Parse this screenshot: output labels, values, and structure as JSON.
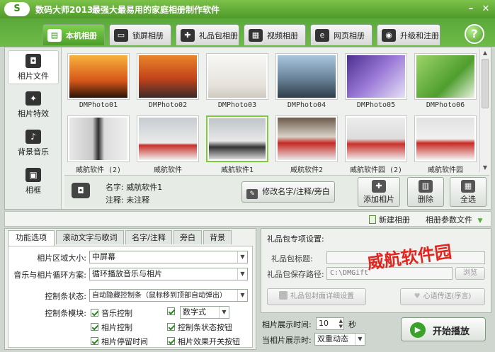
{
  "app": {
    "logo": "S",
    "title": "数码大师2013",
    "slogan": "最强大最易用的家庭相册制作软件",
    "minimize": "–",
    "close": "✕"
  },
  "tabs": [
    {
      "label": "本机相册",
      "icon": "computer-album-icon",
      "glyph": "▤",
      "active": true
    },
    {
      "label": "锁屏相册",
      "icon": "monitor-icon",
      "glyph": "▭",
      "active": false
    },
    {
      "label": "礼品包相册",
      "icon": "gift-icon",
      "glyph": "✚",
      "active": false
    },
    {
      "label": "视频相册",
      "icon": "film-icon",
      "glyph": "▦",
      "active": false
    },
    {
      "label": "网页相册",
      "icon": "ie-icon",
      "glyph": "e",
      "active": false
    },
    {
      "label": "升级和注册",
      "icon": "globe-icon",
      "glyph": "◉",
      "active": false
    }
  ],
  "help": "?",
  "sidebar": {
    "items": [
      {
        "label": "相片文件",
        "icon": "camera-icon",
        "glyph": "◘",
        "active": true
      },
      {
        "label": "相片特效",
        "icon": "effects-icon",
        "glyph": "✦",
        "active": false
      },
      {
        "label": "背景音乐",
        "icon": "music-note-icon",
        "glyph": "♪",
        "active": false
      },
      {
        "label": "相框",
        "icon": "frame-icon",
        "glyph": "▣",
        "active": false
      }
    ]
  },
  "photos": [
    {
      "caption": "DMPhoto01"
    },
    {
      "caption": "DMPhoto02"
    },
    {
      "caption": "DMPhoto03"
    },
    {
      "caption": "DMPhoto04"
    },
    {
      "caption": "DMPhoto05"
    },
    {
      "caption": "DMPhoto06"
    },
    {
      "caption": "威航软件 (2)"
    },
    {
      "caption": "威航软件"
    },
    {
      "caption": "威航软件1"
    },
    {
      "caption": "威航软件2"
    },
    {
      "caption": "威航软件园 (2)"
    },
    {
      "caption": "威航软件园"
    }
  ],
  "info": {
    "name_label": "名字:",
    "name_value": "威航软件1",
    "note_label": "注释:",
    "note_value": "未注释",
    "edit_button": "修改名字/注释/旁白",
    "add_button": "添加相片",
    "delete_button": "删除",
    "select_all_button": "全选"
  },
  "album_bar": {
    "new_album": "新建相册",
    "album_params": "相册参数文件"
  },
  "option_tabs": [
    "功能选项",
    "滚动文字与歌词",
    "名字/注释",
    "旁白",
    "背景"
  ],
  "options": {
    "area_size_label": "相片区域大小:",
    "area_size_value": "中屏幕",
    "loop_label": "音乐与相片循环方案:",
    "loop_value": "循环播放音乐与相片",
    "control_state_label": "控制条状态:",
    "control_state_value": "自动隐藏控制条（鼠标移到顶部自动弹出）",
    "control_module_label": "控制条模块:",
    "checks": [
      {
        "label": "音乐控制",
        "checked": true
      },
      {
        "label": "相片控制",
        "checked": true
      },
      {
        "label": "相片停留时间",
        "checked": true
      },
      {
        "label": "控制条状态按钮",
        "checked": true
      },
      {
        "label": "相片效果开关按钮",
        "checked": true
      }
    ],
    "style_value": "数字式"
  },
  "gift": {
    "title": "礼品包专项设置:",
    "name_label": "礼品包标题:",
    "name_value": "",
    "path_label": "礼品包保存路径:",
    "path_value": "C:\\DMGift",
    "browse": "浏览",
    "cover_button": "礼品包封面详细设置",
    "heart_button": "心语传送(序言)"
  },
  "watermark": "威航软件园",
  "timing": {
    "show_time_label": "相片展示时间:",
    "show_time_value": "10",
    "show_time_unit": "秒",
    "current_label": "当相片展示时:",
    "current_value": "双重动态"
  },
  "play_button": "开始播放"
}
